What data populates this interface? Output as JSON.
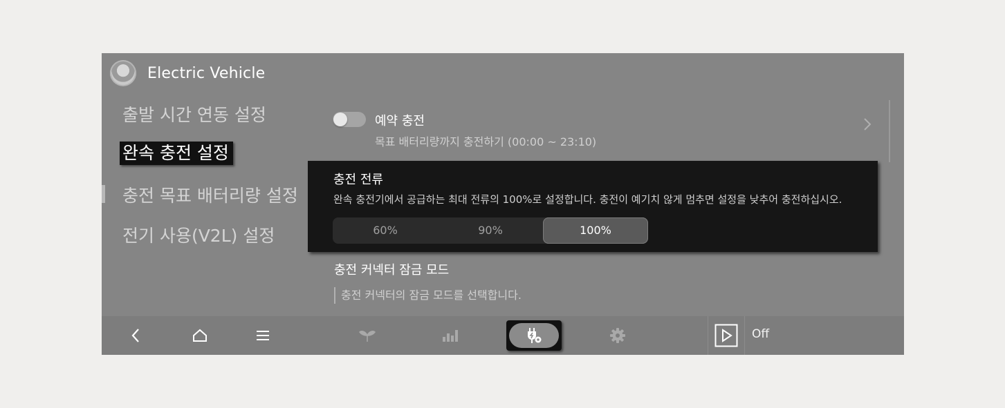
{
  "app": {
    "title": "Electric Vehicle"
  },
  "sidebar": {
    "items": [
      {
        "label": "출발 시간 연동 설정"
      },
      {
        "label": "완속 충전 설정"
      },
      {
        "label": "충전 목표 배터리량 설정"
      },
      {
        "label": "전기 사용(V2L) 설정"
      }
    ],
    "active_index": 1
  },
  "reserved_charging": {
    "title": "예약 충전",
    "subtitle": "목표 배터리량까지 충전하기 (00:00 ~ 23:10)",
    "toggle_on": false
  },
  "charging_current": {
    "title": "충전 전류",
    "description": "완속 충전기에서 공급하는 최대 전류의 100%로 설정합니다. 충전이 예기치 않게 멈추면 설정을 낮추어 충전하십시오.",
    "options": [
      "60%",
      "90%",
      "100%"
    ],
    "selected": "100%"
  },
  "connector_lock": {
    "title": "충전 커넥터 잠금 모드",
    "description": "충전 커넥터의 잠금 모드를 선택합니다."
  },
  "bottom_bar": {
    "media_status": "Off",
    "icons": [
      "back-icon",
      "home-icon",
      "menu-icon",
      "eco-leaf-icon",
      "energy-chart-icon",
      "ev-charging-settings-icon",
      "settings-gear-icon",
      "media-play-icon"
    ]
  },
  "colors": {
    "screen_bg": "#858585",
    "panel_bg": "#161616",
    "nav_bg": "#7d7d7d",
    "text_primary": "#ffffff"
  }
}
